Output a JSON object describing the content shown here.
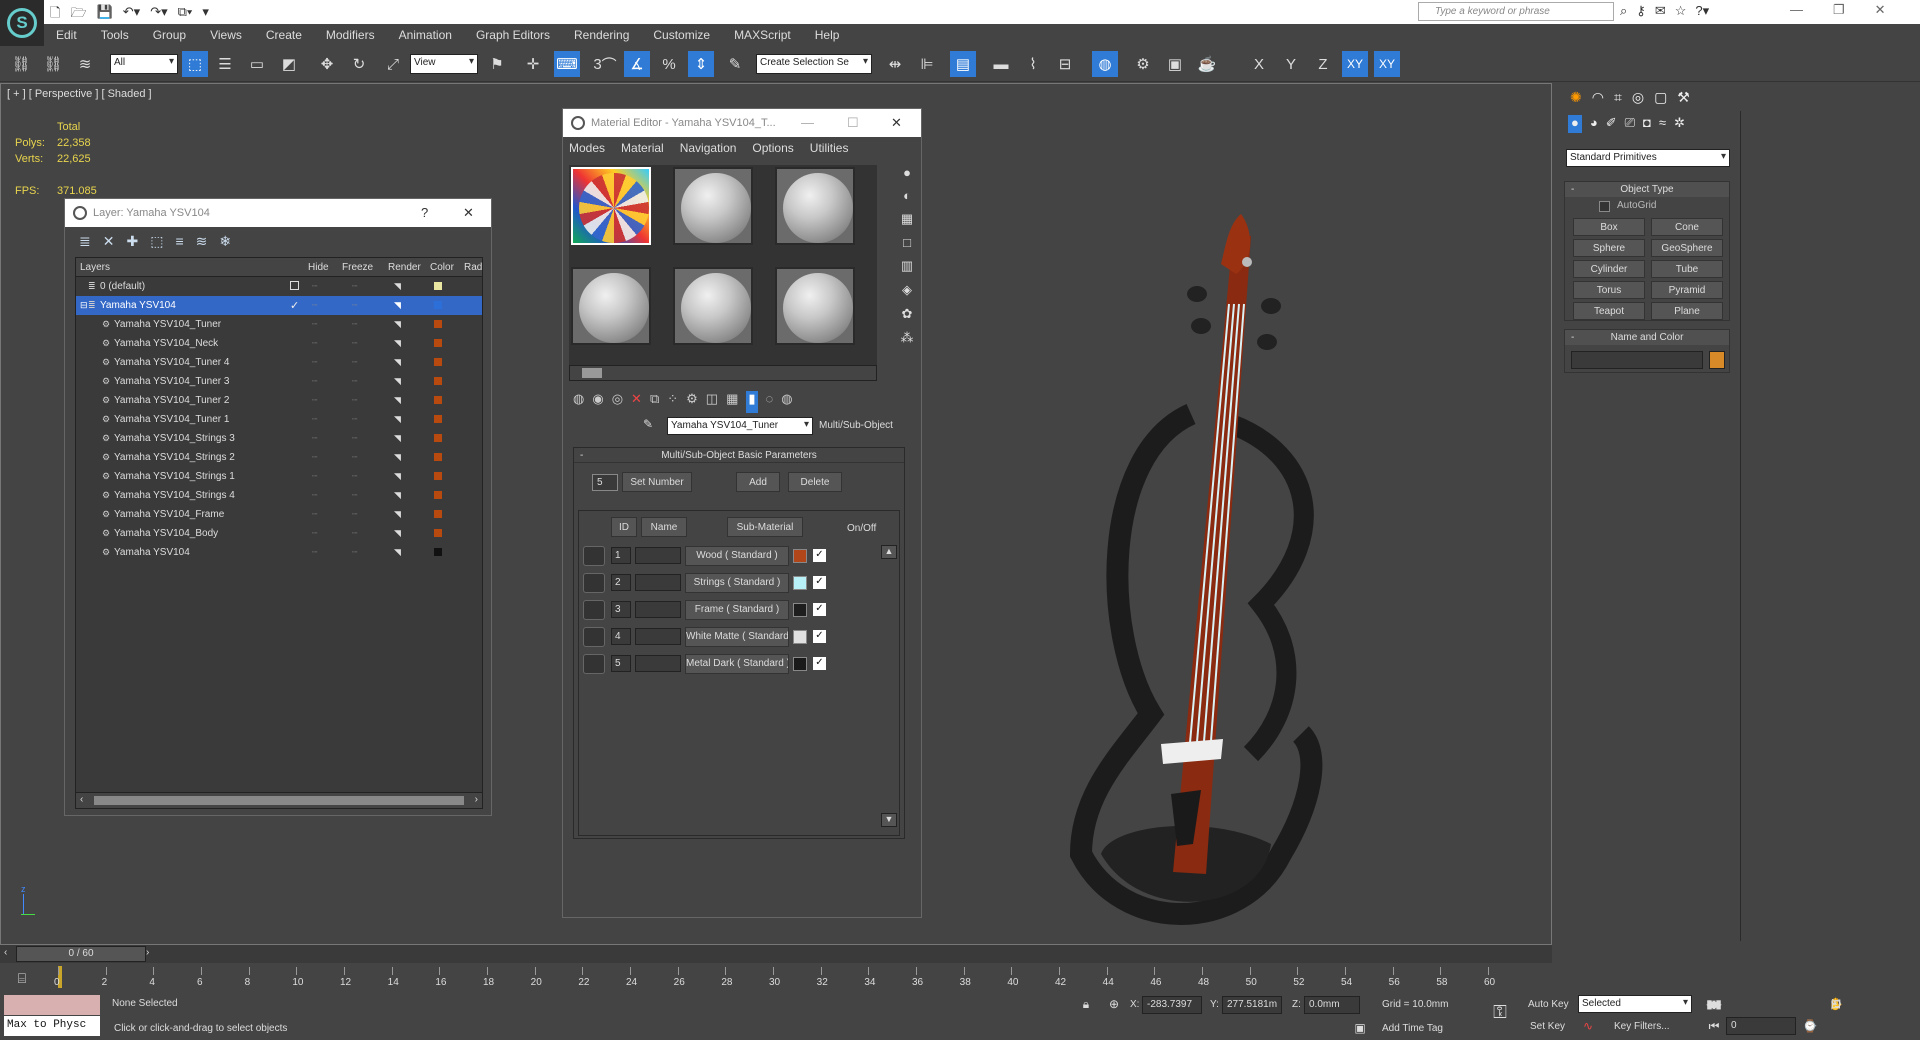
{
  "app": {
    "search_placeholder": "Type a keyword or phrase",
    "menu": [
      "Edit",
      "Tools",
      "Group",
      "Views",
      "Create",
      "Modifiers",
      "Animation",
      "Graph Editors",
      "Rendering",
      "Customize",
      "MAXScript",
      "Help"
    ]
  },
  "toolbar": {
    "filter": "All",
    "ref_coord": "View",
    "selection_set": "Create Selection Se",
    "angle_snap": "3",
    "axes": [
      "X",
      "Y",
      "Z",
      "XY",
      "XY"
    ]
  },
  "viewport": {
    "label": "[ + ] [ Perspective ] [ Shaded ]",
    "stats_total": "Total",
    "polys_label": "Polys:",
    "polys_value": "22,358",
    "verts_label": "Verts:",
    "verts_value": "22,625",
    "fps_label": "FPS:",
    "fps_value": "371.085"
  },
  "layer_window": {
    "title": "Layer: Yamaha YSV104",
    "help": "?",
    "close": "✕",
    "col_layers": "Layers",
    "col_hide": "Hide",
    "col_freeze": "Freeze",
    "col_render": "Render",
    "col_color": "Color",
    "col_rad": "Rad",
    "rows": [
      {
        "name": "0 (default)",
        "color": "#e8e6a0"
      },
      {
        "name": "Yamaha YSV104",
        "color": "#2d6fd8"
      },
      {
        "name": "Yamaha YSV104_Tuner",
        "color": "#b84a10"
      },
      {
        "name": "Yamaha YSV104_Neck",
        "color": "#b84a10"
      },
      {
        "name": "Yamaha YSV104_Tuner 4",
        "color": "#b84a10"
      },
      {
        "name": "Yamaha YSV104_Tuner 3",
        "color": "#b84a10"
      },
      {
        "name": "Yamaha YSV104_Tuner 2",
        "color": "#b84a10"
      },
      {
        "name": "Yamaha YSV104_Tuner 1",
        "color": "#b84a10"
      },
      {
        "name": "Yamaha YSV104_Strings 3",
        "color": "#b84a10"
      },
      {
        "name": "Yamaha YSV104_Strings 2",
        "color": "#b84a10"
      },
      {
        "name": "Yamaha YSV104_Strings 1",
        "color": "#b84a10"
      },
      {
        "name": "Yamaha YSV104_Strings 4",
        "color": "#b84a10"
      },
      {
        "name": "Yamaha YSV104_Frame",
        "color": "#b84a10"
      },
      {
        "name": "Yamaha YSV104_Body",
        "color": "#b84a10"
      },
      {
        "name": "Yamaha YSV104",
        "color": "#111111"
      }
    ]
  },
  "material_editor": {
    "title": "Material Editor - Yamaha YSV104_T...",
    "menu": [
      "Modes",
      "Material",
      "Navigation",
      "Options",
      "Utilities"
    ],
    "material_name": "Yamaha YSV104_Tuner",
    "material_type": "Multi/Sub-Object",
    "rollout_title": "Multi/Sub-Object Basic Parameters",
    "set_number_value": "5",
    "set_number_label": "Set Number",
    "add_label": "Add",
    "delete_label": "Delete",
    "col_id": "ID",
    "col_name": "Name",
    "col_submaterial": "Sub-Material",
    "col_onoff": "On/Off",
    "submaterials": [
      {
        "id": "1",
        "name": "Wood  ( Standard )",
        "color": "#b0461a"
      },
      {
        "id": "2",
        "name": "Strings  ( Standard )",
        "color": "#b8f0f8"
      },
      {
        "id": "3",
        "name": "Frame  ( Standard )",
        "color": "#1e1e1e"
      },
      {
        "id": "4",
        "name": "White Matte  ( Standard )",
        "color": "#e0e0e0"
      },
      {
        "id": "5",
        "name": "Metal Dark  ( Standard )",
        "color": "#1a1a1a"
      }
    ]
  },
  "command_panel": {
    "category": "Standard Primitives",
    "object_type_title": "Object Type",
    "autogrid": "AutoGrid",
    "buttons": [
      "Box",
      "Cone",
      "Sphere",
      "GeoSphere",
      "Cylinder",
      "Tube",
      "Torus",
      "Pyramid",
      "Teapot",
      "Plane"
    ],
    "name_color_title": "Name and Color",
    "object_color": "#d88a28"
  },
  "timeline": {
    "frame": "0 / 60",
    "ticks": [
      "0",
      "2",
      "4",
      "6",
      "8",
      "10",
      "12",
      "14",
      "16",
      "18",
      "20",
      "22",
      "24",
      "26",
      "28",
      "30",
      "32",
      "34",
      "36",
      "38",
      "40",
      "42",
      "44",
      "46",
      "48",
      "50",
      "52",
      "54",
      "56",
      "58",
      "60"
    ]
  },
  "status": {
    "script_listener": "Max to Physc",
    "selection": "None Selected",
    "prompt": "Click or click-and-drag to select objects",
    "x_label": "X:",
    "x_value": "-283.7397",
    "y_label": "Y:",
    "y_value": "277.5181m",
    "z_label": "Z:",
    "z_value": "0.0mm",
    "grid": "Grid = 10.0mm",
    "add_time_tag": "Add Time Tag",
    "auto_key": "Auto Key",
    "set_key": "Set Key",
    "key_mode": "Selected",
    "key_filters": "Key Filters...",
    "current_frame": "0"
  }
}
